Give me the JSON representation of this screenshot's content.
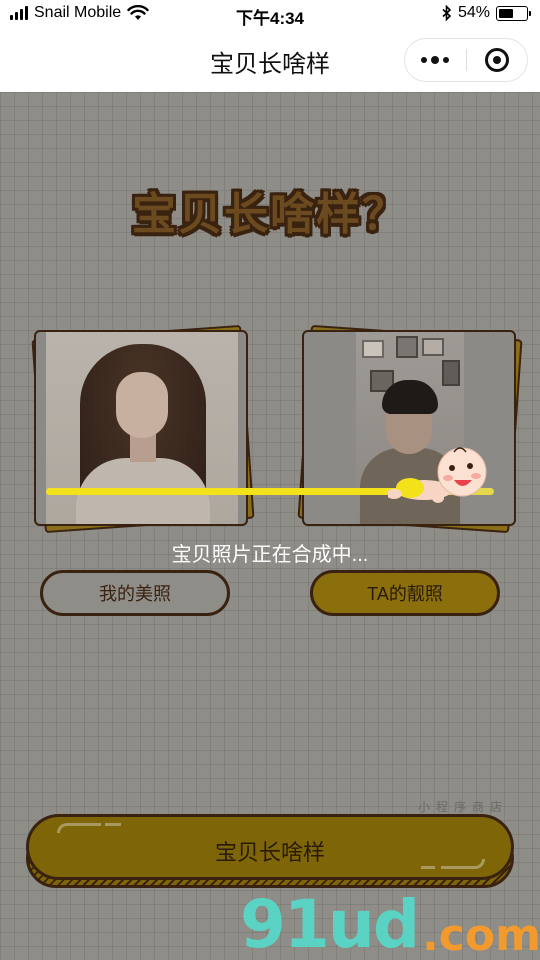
{
  "status_bar": {
    "carrier": "Snail Mobile",
    "time": "下午4:34",
    "battery_percent": "54%",
    "battery_level": 0.54,
    "icons": [
      "signal-icon",
      "wifi-icon",
      "bluetooth-icon",
      "battery-icon"
    ]
  },
  "nav": {
    "title": "宝贝长啥样",
    "more_icon": "more-dots-icon",
    "close_icon": "close-miniprogram-icon"
  },
  "main": {
    "heading": "宝贝长啥样？",
    "photo_left_icon": "user-photo",
    "photo_right_icon": "partner-photo",
    "progress_level": 0.82,
    "status_text": "宝贝照片正在合成中...",
    "btn_my_photo": "我的美照",
    "btn_ta_photo": "TA的靓照",
    "btn_generate": "宝贝长啥样"
  },
  "watermark": {
    "logo": "91ud",
    "dot": ".",
    "tld": "com",
    "chinese": "小程序商店"
  },
  "colors": {
    "accent_gold": "#8a6f0c",
    "outline_brown": "#3a2210",
    "progress_yellow": "#f3e21a",
    "overlay_gray": "#8f8d88"
  }
}
